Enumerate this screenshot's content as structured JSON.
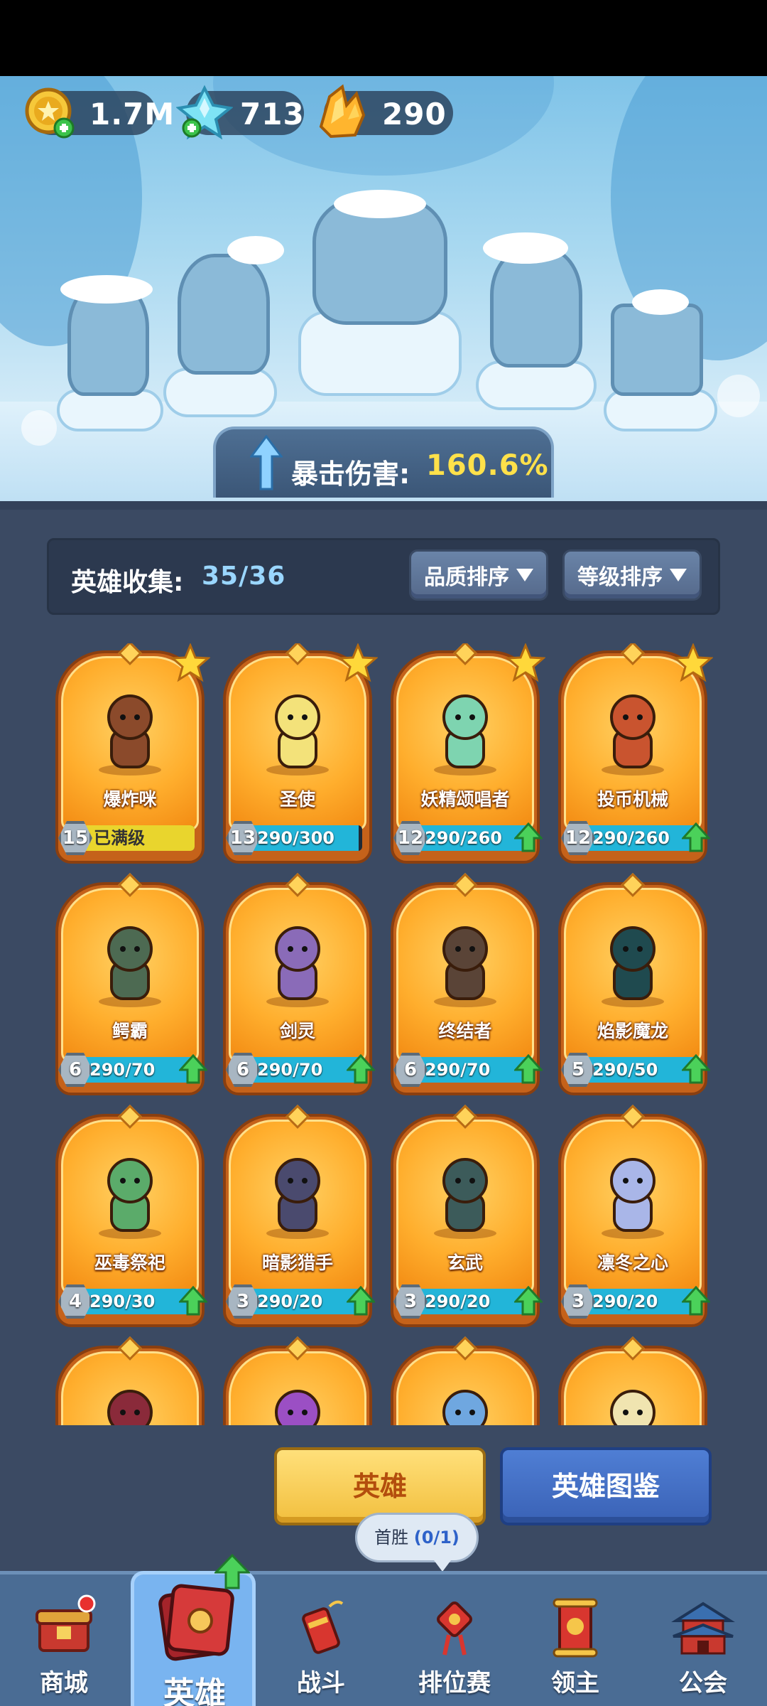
{
  "resources": {
    "gold": "1.7M",
    "crystal": "713",
    "ore": "290"
  },
  "buff": {
    "label": "暴击伤害:",
    "value": "160.6%"
  },
  "collection": {
    "label": "英雄收集:",
    "value": "35/36"
  },
  "sort": {
    "quality": "品质排序",
    "level": "等级排序"
  },
  "heroes": [
    {
      "name": "爆炸咪",
      "level": "15",
      "progress": "已满级",
      "fill": 1.0,
      "maxed": true,
      "star": true,
      "upgrade": false,
      "color": "#8b4a2b"
    },
    {
      "name": "圣使",
      "level": "13",
      "progress": "290/300",
      "fill": 0.97,
      "maxed": false,
      "star": true,
      "upgrade": false,
      "color": "#f3e27a"
    },
    {
      "name": "妖精颂唱者",
      "level": "12",
      "progress": "290/260",
      "fill": 1.0,
      "maxed": false,
      "star": true,
      "upgrade": true,
      "color": "#7ed4b0"
    },
    {
      "name": "投币机械",
      "level": "12",
      "progress": "290/260",
      "fill": 1.0,
      "maxed": false,
      "star": true,
      "upgrade": true,
      "color": "#c9542f"
    },
    {
      "name": "鳄霸",
      "level": "6",
      "progress": "290/70",
      "fill": 1.0,
      "maxed": false,
      "star": false,
      "upgrade": true,
      "color": "#4d6a52"
    },
    {
      "name": "剑灵",
      "level": "6",
      "progress": "290/70",
      "fill": 1.0,
      "maxed": false,
      "star": false,
      "upgrade": true,
      "color": "#8a6bb8"
    },
    {
      "name": "终结者",
      "level": "6",
      "progress": "290/70",
      "fill": 1.0,
      "maxed": false,
      "star": false,
      "upgrade": true,
      "color": "#5a4437"
    },
    {
      "name": "焰影魔龙",
      "level": "5",
      "progress": "290/50",
      "fill": 1.0,
      "maxed": false,
      "star": false,
      "upgrade": true,
      "color": "#1f4a4f"
    },
    {
      "name": "巫毒祭祀",
      "level": "4",
      "progress": "290/30",
      "fill": 1.0,
      "maxed": false,
      "star": false,
      "upgrade": true,
      "color": "#5bab6a"
    },
    {
      "name": "暗影猎手",
      "level": "3",
      "progress": "290/20",
      "fill": 1.0,
      "maxed": false,
      "star": false,
      "upgrade": true,
      "color": "#4a4a6e"
    },
    {
      "name": "玄武",
      "level": "3",
      "progress": "290/20",
      "fill": 1.0,
      "maxed": false,
      "star": false,
      "upgrade": true,
      "color": "#3c5b5a"
    },
    {
      "name": "凛冬之心",
      "level": "3",
      "progress": "290/20",
      "fill": 1.0,
      "maxed": false,
      "star": false,
      "upgrade": true,
      "color": "#a9b6e8"
    },
    {
      "name": "",
      "level": "",
      "progress": "",
      "fill": 0,
      "maxed": false,
      "star": false,
      "upgrade": false,
      "color": "#8a2a3a"
    },
    {
      "name": "",
      "level": "",
      "progress": "",
      "fill": 0,
      "maxed": false,
      "star": false,
      "upgrade": false,
      "color": "#9b4fc4"
    },
    {
      "name": "",
      "level": "",
      "progress": "",
      "fill": 0,
      "maxed": false,
      "star": false,
      "upgrade": false,
      "color": "#6fa7e0"
    },
    {
      "name": "",
      "level": "",
      "progress": "",
      "fill": 0,
      "maxed": false,
      "star": false,
      "upgrade": false,
      "color": "#f0e4b0"
    }
  ],
  "buttons": {
    "heroes": "英雄",
    "codex": "英雄图鉴"
  },
  "tooltip": {
    "label": "首胜",
    "count": "(0/1)"
  },
  "nav": {
    "shop": "商城",
    "heroes": "英雄",
    "battle": "战斗",
    "ranked": "排位赛",
    "lord": "领主",
    "guild": "公会"
  }
}
